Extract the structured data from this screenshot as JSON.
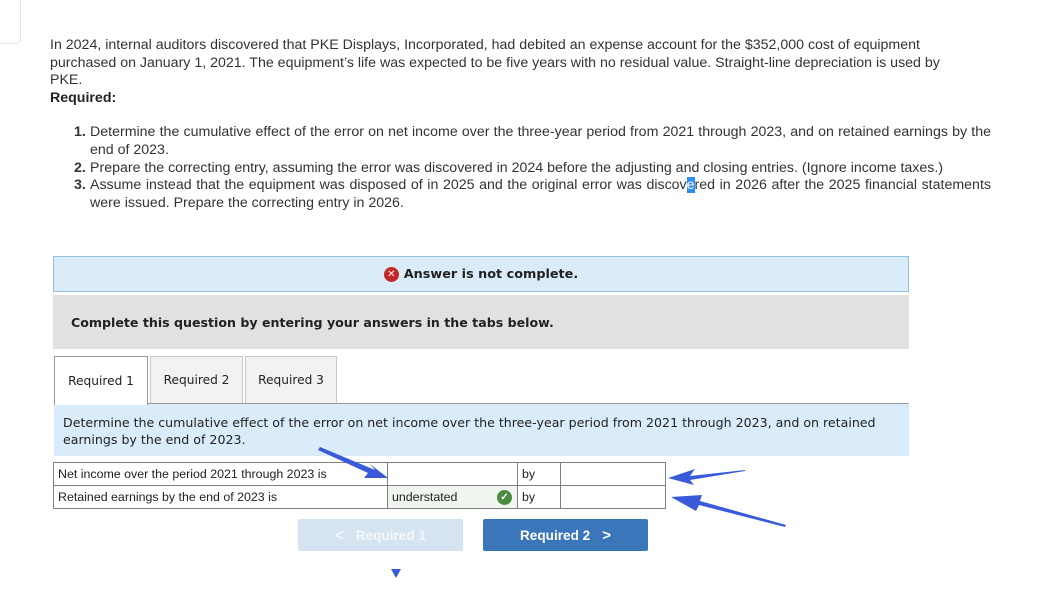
{
  "problem": {
    "intro": "In 2024, internal auditors discovered that PKE Displays, Incorporated, had debited an expense account for the $352,000 cost of equipment purchased on January 1, 2021. The equipment’s life was expected to be five years with no residual value. Straight-line depreciation is used by PKE.",
    "required_heading": "Required:",
    "requirements": [
      {
        "num": "1.",
        "text": "Determine the cumulative effect of the error on net income over the three-year period from 2021 through 2023, and on retained earnings by the end of 2023."
      },
      {
        "num": "2.",
        "text": "Prepare the correcting entry, assuming the error was discovered in 2024 before the adjusting and closing entries. (Ignore income taxes.)"
      },
      {
        "num": "3.",
        "text_before": "Assume instead that the equipment was disposed of in 2025 and the original error was discov",
        "text_selected": "e",
        "text_after": "red in 2026 after the 2025 financial statements were issued. Prepare the correcting entry in 2026."
      }
    ]
  },
  "banner": {
    "status_icon": "x-circle-icon",
    "message": "Answer is not complete."
  },
  "instruction": "Complete this question by entering your answers in the tabs below.",
  "tabs": [
    {
      "label": "Required 1",
      "active": true
    },
    {
      "label": "Required 2",
      "active": false
    },
    {
      "label": "Required 3",
      "active": false
    }
  ],
  "panel": {
    "prompt": "Determine the cumulative effect of the error on net income over the three-year period from 2021 through 2023, and on retained earnings by the end of 2023.",
    "rows": [
      {
        "label": "Net income over the period 2021 through 2023 is",
        "choice": "",
        "choice_status": "",
        "by": "by",
        "amount": ""
      },
      {
        "label": "Retained earnings by the end of 2023 is",
        "choice": "understated",
        "choice_status": "correct",
        "by": "by",
        "amount": ""
      }
    ]
  },
  "navigation": {
    "prev_label": "Required 1",
    "prev_enabled": false,
    "next_label": "Required 2",
    "next_enabled": true
  },
  "colors": {
    "accent": "#3a76b9",
    "banner_bg": "#daecf9",
    "error": "#c62828",
    "success": "#4a8b3e",
    "annotation_arrow": "#3a5bd9"
  }
}
